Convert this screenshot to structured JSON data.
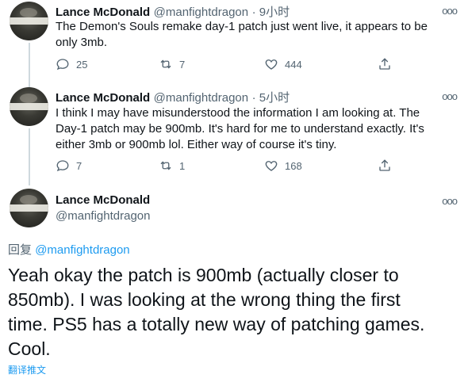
{
  "tweets": [
    {
      "name": "Lance McDonald",
      "handle": "@manfightdragon",
      "time": "· 9小时",
      "lines": [
        "The Demon's Souls remake day-1 patch just went live, it appears to be",
        "only 3mb."
      ],
      "replies": "25",
      "retweets": "7",
      "likes": "444"
    },
    {
      "name": "Lance McDonald",
      "handle": "@manfightdragon",
      "time": "· 5小时",
      "lines": [
        "I think I may have misunderstood the information I am looking at. The",
        "Day-1 patch may be 900mb. It's hard for me to understand exactly. It's",
        "either 3mb or 900mb lol. Either way of course it's tiny."
      ],
      "replies": "7",
      "retweets": "1",
      "likes": "168"
    }
  ],
  "main_tweet": {
    "name": "Lance McDonald",
    "handle": "@manfightdragon",
    "reply_prefix": "回复",
    "reply_to": "@manfightdragon",
    "lines": [
      "Yeah okay the patch is 900mb (actually closer to",
      "850mb). I was looking at the wrong thing the first",
      "time. PS5 has a totally new way of patching games.",
      "Cool."
    ],
    "translate": "翻译推文"
  },
  "more_label": "ooo",
  "colors": {
    "link": "#1d9bf0",
    "secondary": "#536471",
    "primary": "#0f1419"
  }
}
